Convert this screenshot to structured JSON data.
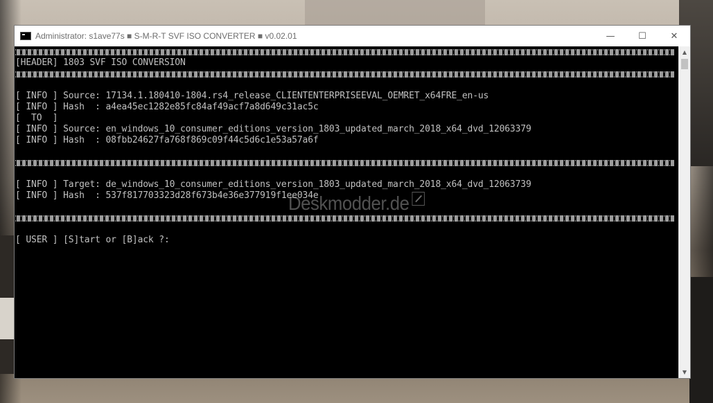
{
  "window": {
    "title": "Administrator:  s1ave77s ■ S-M-R-T SVF ISO CONVERTER ■ v0.02.01",
    "controls": {
      "minimize": "—",
      "maximize": "☐",
      "close": "✕"
    }
  },
  "console": {
    "header": "[HEADER] 1803 SVF ISO CONVERSION",
    "info_source_1": "[ INFO ] Source: 17134.1.180410-1804.rs4_release_CLIENTENTERPRISEEVAL_OEMRET_x64FRE_en-us",
    "info_hash_1": "[ INFO ] Hash  : a4ea45ec1282e85fc84af49acf7a8d649c31ac5c",
    "to_line": "[  TO  ]",
    "info_source_2": "[ INFO ] Source: en_windows_10_consumer_editions_version_1803_updated_march_2018_x64_dvd_12063379",
    "info_hash_2": "[ INFO ] Hash  : 08fbb24627fa768f869c09f44c5d6c1e53a57a6f",
    "info_target": "[ INFO ] Target: de_windows_10_consumer_editions_version_1803_updated_march_2018_x64_dvd_12063739",
    "info_hash_3": "[ INFO ] Hash  : 537f817703323d28f673b4e36e377919f1ee034e",
    "prompt": "[ USER ] [S]tart or [B]ack ?:"
  },
  "watermark": "Deskmodder.de",
  "icons": {
    "app": "console-icon",
    "scroll_up": "chevron-up-icon",
    "scroll_down": "chevron-down-icon"
  }
}
